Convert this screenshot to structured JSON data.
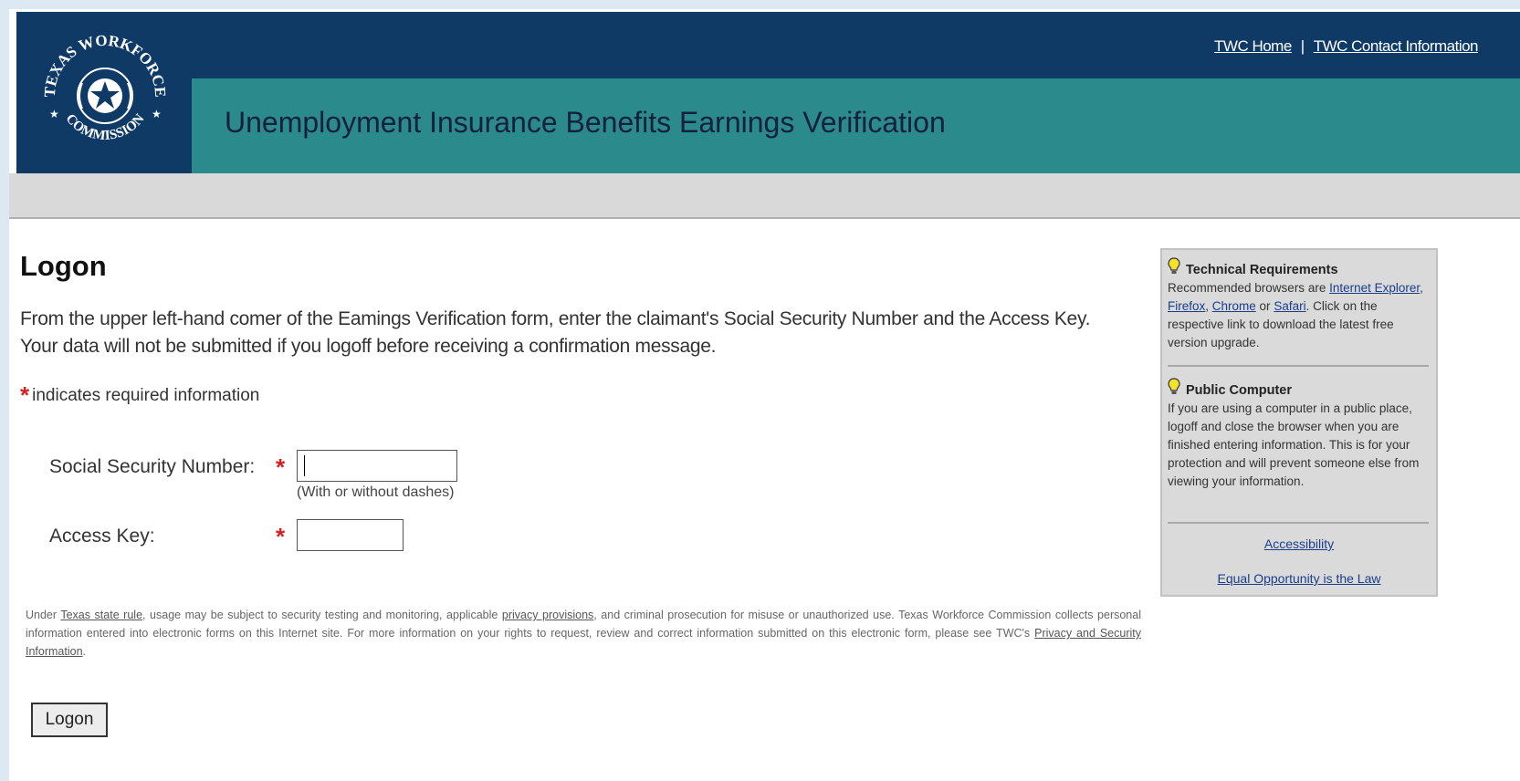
{
  "header": {
    "logo_top_text": "TEXAS WORKFORCE",
    "logo_bottom_text": "COMMISSION",
    "nav_home": "TWC Home",
    "nav_separator": "|",
    "nav_contact": "TWC Contact Information",
    "title": "Unemployment Insurance Benefits Earnings Verification"
  },
  "main": {
    "heading": "Logon",
    "intro": "From the upper left-hand comer of the Eamings Verification form, enter the claimant's Social Security Number and the Access Key. Your data will not be submitted if you logoff before receiving a confirmation message.",
    "required_star": "*",
    "required_note": "indicates required information",
    "ssn_label": "Social Security Number:",
    "ssn_value": "",
    "ssn_hint": "(With or without dashes)",
    "key_label": "Access Key:",
    "key_value": "",
    "legal": {
      "p1": "Under ",
      "link1": "Texas state rule",
      "p2": ", usage may be subject to security testing and monitoring, applicable ",
      "link2": "privacy provisions",
      "p3": ", and criminal prosecution for misuse or unauthorized use. Texas Workforce Commission collects personal information entered into electronic forms on this Internet site. For more information on your rights to request, review and correct information submitted on this electronic form, please see TWC's ",
      "link3": "Privacy and Security Information",
      "p4": "."
    },
    "logon_button": "Logon"
  },
  "sidebar": {
    "tech_title": "Technical Requirements",
    "tech_text1": "Recommended browsers are ",
    "link_ie": "Internet Explorer",
    "comma1": ", ",
    "link_firefox": "Firefox",
    "comma2": ", ",
    "link_chrome": "Chrome",
    "or_text": " or ",
    "link_safari": "Safari",
    "tech_text2": ". Click on the respective link to download the latest free version upgrade.",
    "public_title": "Public Computer",
    "public_text": "If you are using a computer in a public place, logoff and close the browser when you are finished entering information. This is for your protection and will prevent someone else from viewing your information.",
    "link_accessibility": "Accessibility",
    "link_equal": "Equal Opportunity is the Law"
  },
  "colors": {
    "header_navy": "#0f3a66",
    "title_teal": "#2a8a8c",
    "required_red": "#d32020"
  },
  "icons": {
    "logo": "texas-star-seal-icon",
    "tip": "lightbulb-icon"
  }
}
